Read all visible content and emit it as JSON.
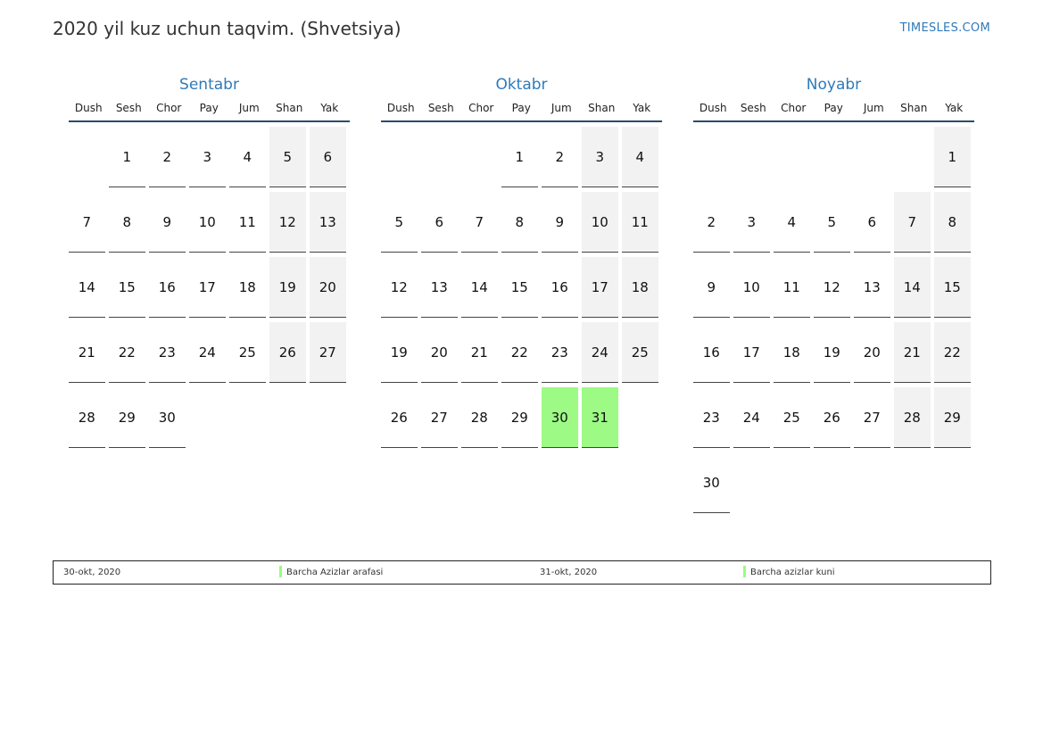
{
  "title": "2020 yil kuz uchun taqvim. (Shvetsiya)",
  "site": "TIMESLES.COM",
  "colors": {
    "accent": "#2f7ab9",
    "holiday": "#9cfa85",
    "weekend": "#f2f2f2"
  },
  "weekdays": [
    "Dush",
    "Sesh",
    "Chor",
    "Pay",
    "Jum",
    "Shan",
    "Yak"
  ],
  "months": [
    {
      "name": "Sentabr",
      "weeks": [
        [
          "",
          "1",
          "2",
          "3",
          "4",
          "5",
          "6"
        ],
        [
          "7",
          "8",
          "9",
          "10",
          "11",
          "12",
          "13"
        ],
        [
          "14",
          "15",
          "16",
          "17",
          "18",
          "19",
          "20"
        ],
        [
          "21",
          "22",
          "23",
          "24",
          "25",
          "26",
          "27"
        ],
        [
          "28",
          "29",
          "30",
          "",
          "",
          "",
          ""
        ]
      ],
      "holidays": []
    },
    {
      "name": "Oktabr",
      "weeks": [
        [
          "",
          "",
          "",
          "1",
          "2",
          "3",
          "4"
        ],
        [
          "5",
          "6",
          "7",
          "8",
          "9",
          "10",
          "11"
        ],
        [
          "12",
          "13",
          "14",
          "15",
          "16",
          "17",
          "18"
        ],
        [
          "19",
          "20",
          "21",
          "22",
          "23",
          "24",
          "25"
        ],
        [
          "26",
          "27",
          "28",
          "29",
          "30",
          "31",
          ""
        ]
      ],
      "holidays": [
        "30",
        "31"
      ]
    },
    {
      "name": "Noyabr",
      "weeks": [
        [
          "",
          "",
          "",
          "",
          "",
          "",
          "1"
        ],
        [
          "2",
          "3",
          "4",
          "5",
          "6",
          "7",
          "8"
        ],
        [
          "9",
          "10",
          "11",
          "12",
          "13",
          "14",
          "15"
        ],
        [
          "16",
          "17",
          "18",
          "19",
          "20",
          "21",
          "22"
        ],
        [
          "23",
          "24",
          "25",
          "26",
          "27",
          "28",
          "29"
        ],
        [
          "30",
          "",
          "",
          "",
          "",
          "",
          ""
        ]
      ],
      "holidays": []
    }
  ],
  "legend": [
    {
      "date": "30-okt, 2020",
      "name": "Barcha Azizlar arafasi"
    },
    {
      "date": "31-okt, 2020",
      "name": "Barcha azizlar kuni"
    }
  ]
}
